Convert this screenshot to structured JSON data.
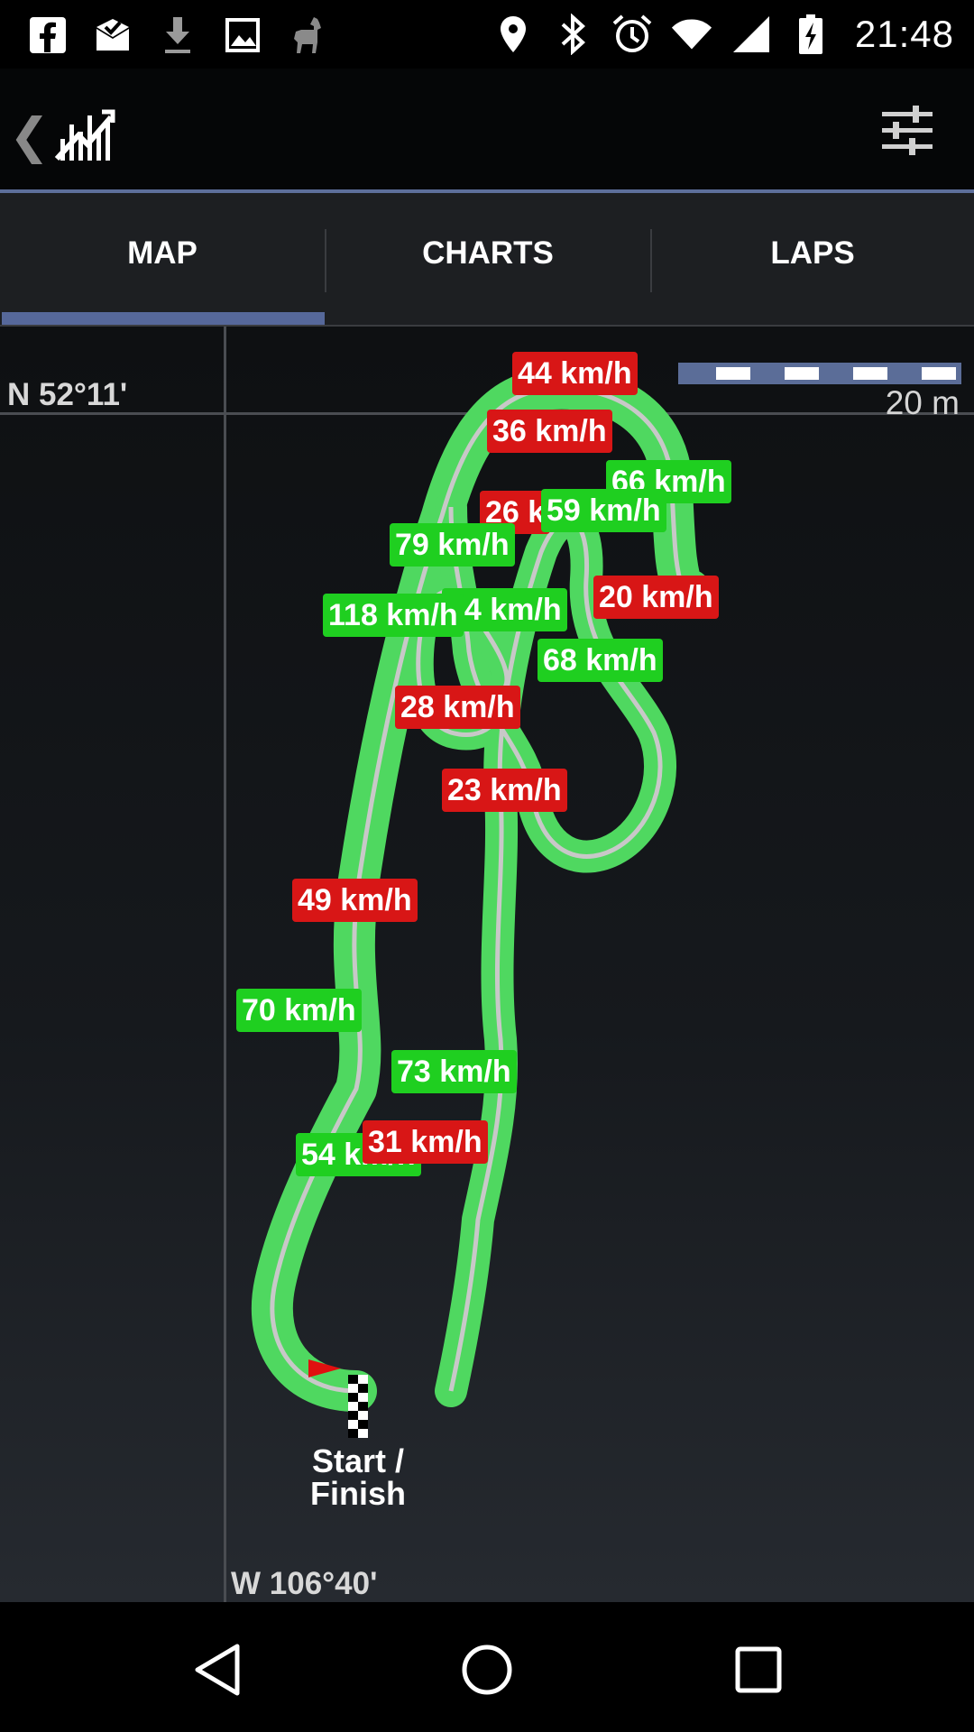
{
  "status_bar": {
    "time": "21:48",
    "left_icons": [
      "facebook-icon",
      "mail-check-icon",
      "download-icon",
      "image-icon",
      "llama-icon"
    ],
    "right_icons": [
      "location-icon",
      "bluetooth-icon",
      "alarm-icon",
      "wifi-icon",
      "signal-icon",
      "battery-charging-icon"
    ]
  },
  "app_bar": {
    "back_icon": "chevron-left-icon",
    "logo_icon": "chart-logo-icon",
    "settings_icon": "sliders-icon",
    "accent_color": "#5d6f9b"
  },
  "tabs": [
    {
      "label": "MAP",
      "active": true
    },
    {
      "label": "CHARTS",
      "active": false
    },
    {
      "label": "LAPS",
      "active": false
    }
  ],
  "map": {
    "latitude_label": "N 52°11'",
    "longitude_label": "W 106°40'",
    "scale_label": "20 m",
    "speed_labels": [
      {
        "text": "44 km/h",
        "type": "slow"
      },
      {
        "text": "36 km/h",
        "type": "slow"
      },
      {
        "text": "66 km/h",
        "type": "fast"
      },
      {
        "text": "26 k",
        "type": "slow"
      },
      {
        "text": "59 km/h",
        "type": "fast"
      },
      {
        "text": "79 km/h",
        "type": "fast"
      },
      {
        "text": "20 km/h",
        "type": "slow"
      },
      {
        "text": "74 km/h",
        "type": "fast"
      },
      {
        "text": "118 km/h",
        "type": "fast"
      },
      {
        "text": "68 km/h",
        "type": "fast"
      },
      {
        "text": "28 km/h",
        "type": "slow"
      },
      {
        "text": "23 km/h",
        "type": "slow"
      },
      {
        "text": "49 km/h",
        "type": "slow"
      },
      {
        "text": "70 km/h",
        "type": "fast"
      },
      {
        "text": "73 km/h",
        "type": "fast"
      },
      {
        "text": "54 km/h",
        "type": "fast"
      },
      {
        "text": "31 km/h",
        "type": "slow"
      }
    ],
    "start_finish_label": "Start / Finish",
    "colors": {
      "slow": "#d81616",
      "fast": "#1fcf20",
      "track_band": "#4fd860",
      "track_line": "#c8c8c8"
    }
  },
  "nav_bar": {
    "icons": [
      "back-triangle-icon",
      "home-circle-icon",
      "recents-square-icon"
    ]
  }
}
